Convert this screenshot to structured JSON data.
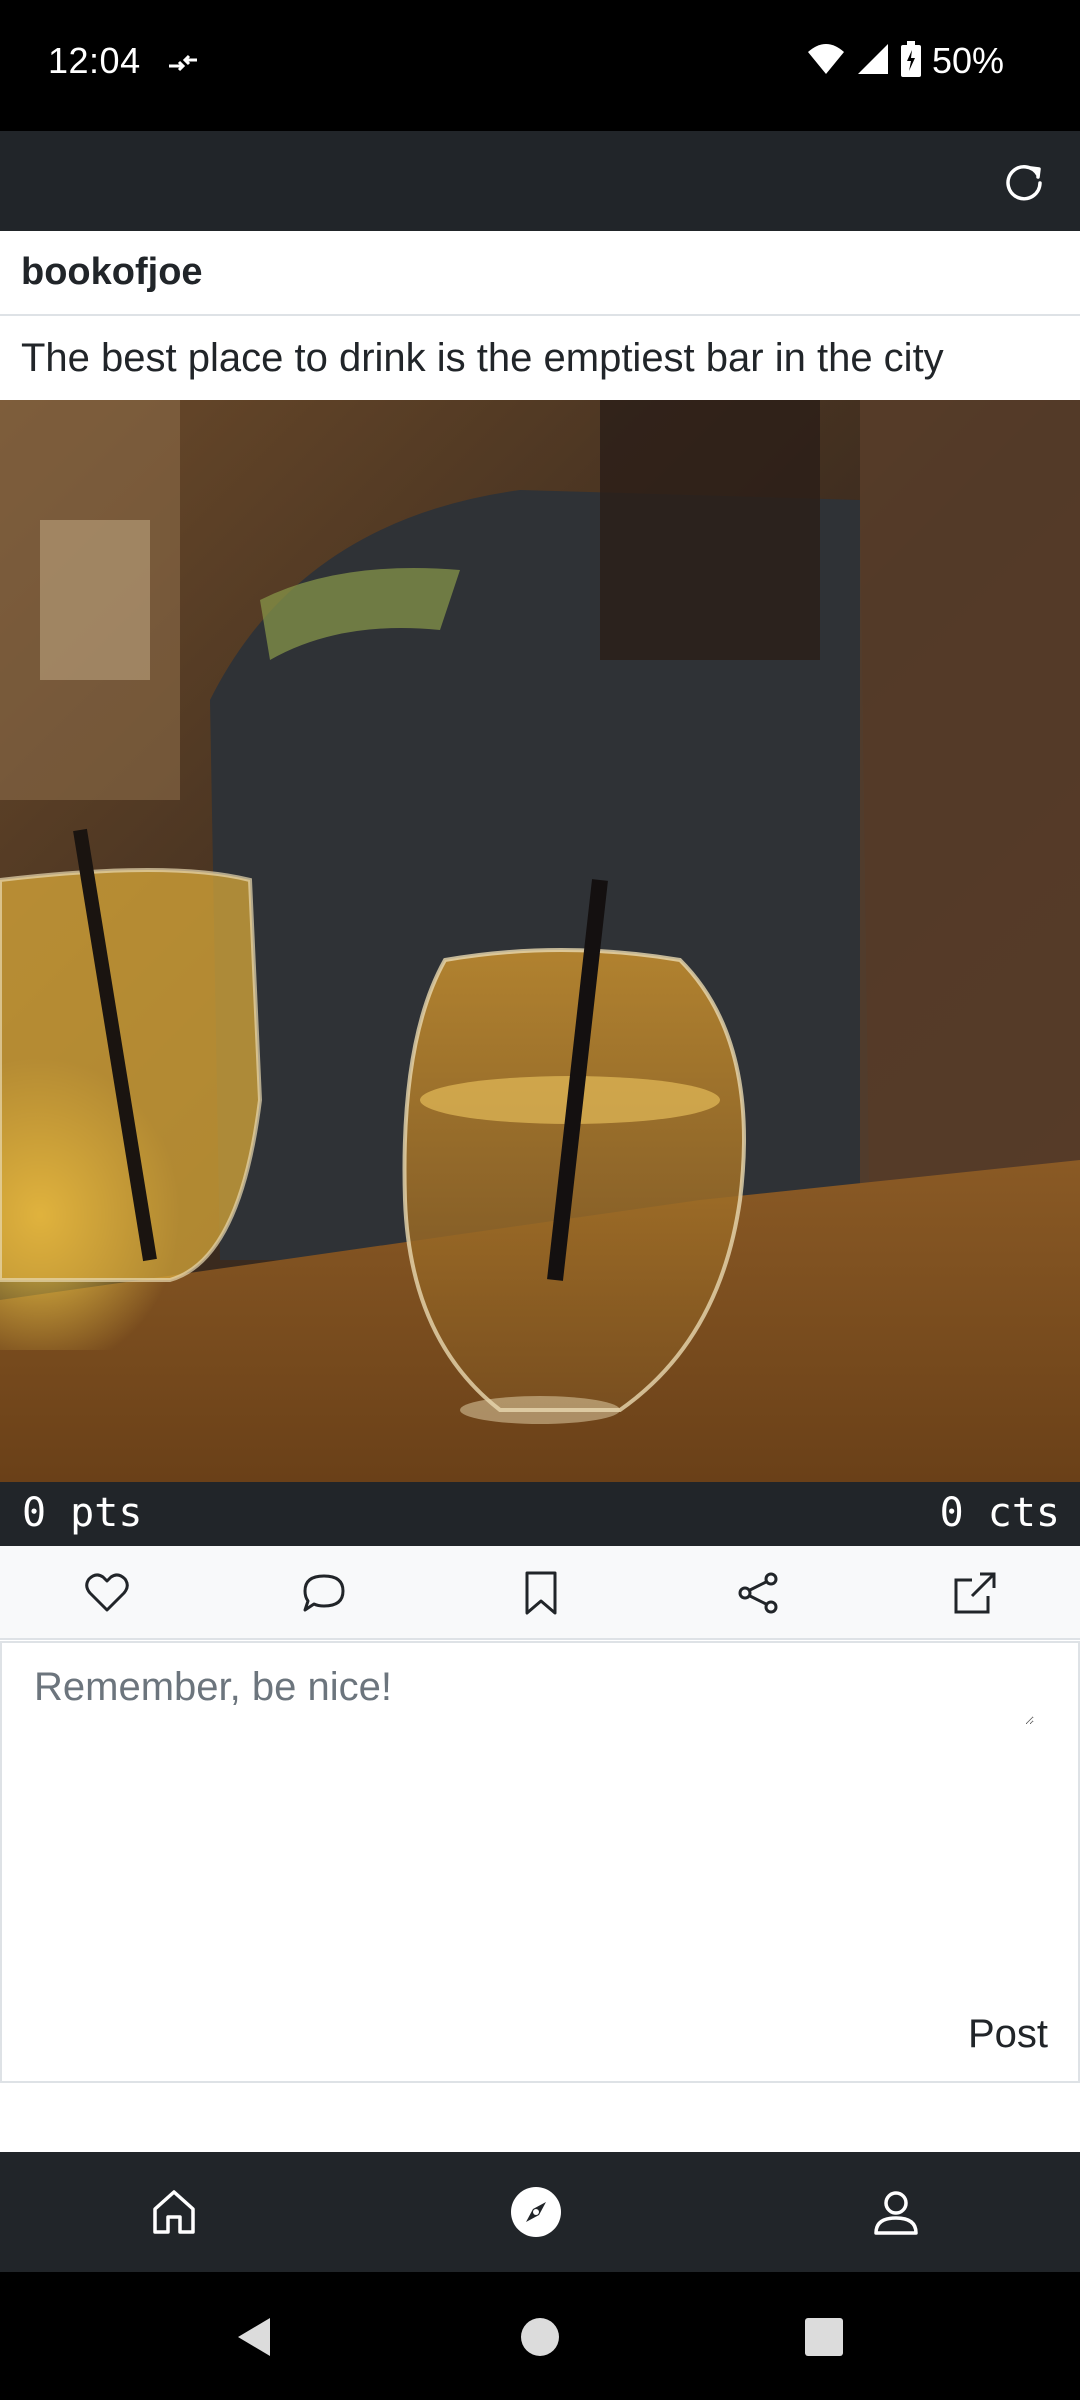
{
  "status_bar": {
    "time": "12:04",
    "battery": "50%"
  },
  "post": {
    "author": "bookofjoe",
    "title": "The best place to drink is the emptiest bar in the city",
    "points": "0 pts",
    "comments_count": "0 cts"
  },
  "comment": {
    "placeholder": "Remember, be nice!",
    "post_label": "Post"
  },
  "icons": {
    "refresh": "refresh-icon",
    "like": "heart-icon",
    "comment": "comment-icon",
    "bookmark": "bookmark-icon",
    "share": "share-icon",
    "external": "external-link-icon",
    "home": "home-icon",
    "explore": "compass-icon",
    "profile": "person-icon"
  },
  "colors": {
    "bar": "#212529",
    "action_row": "#f8f9fa",
    "border": "#dee2e6"
  }
}
